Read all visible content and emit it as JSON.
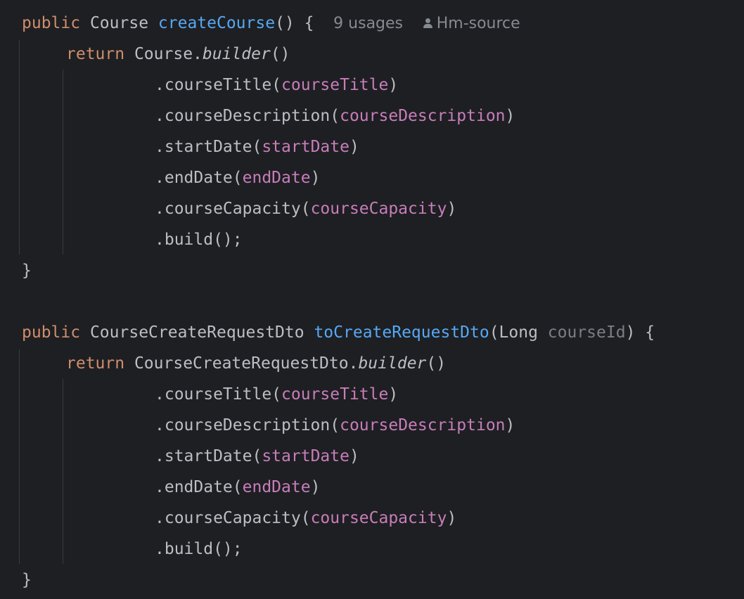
{
  "colors": {
    "background": "#1e1f22",
    "default_text": "#bcbec4",
    "keyword": "#cf8e6d",
    "method_declaration": "#56a8f5",
    "field": "#c77dbb",
    "unused_parameter": "#7a7e85",
    "inlay_hint": "#868a91",
    "indent_guide": "#393b40"
  },
  "code": {
    "method1": {
      "modifier": "public",
      "return_type": "Course",
      "name": "createCourse",
      "signature_tail": "() {",
      "usages_hint": "9 usages",
      "author_icon": "person-icon",
      "author_hint": "Hm-source",
      "return_keyword": "return",
      "builder_class": "Course.",
      "builder_method": "builder",
      "builder_parens": "()",
      "chain": [
        {
          "call": ".courseTitle(",
          "arg": "courseTitle",
          "close": ")"
        },
        {
          "call": ".courseDescription(",
          "arg": "courseDescription",
          "close": ")"
        },
        {
          "call": ".startDate(",
          "arg": "startDate",
          "close": ")"
        },
        {
          "call": ".endDate(",
          "arg": "endDate",
          "close": ")"
        },
        {
          "call": ".courseCapacity(",
          "arg": "courseCapacity",
          "close": ")"
        }
      ],
      "build_call": ".build();",
      "closing_brace": "}"
    },
    "method2": {
      "modifier": "public",
      "return_type": "CourseCreateRequestDto",
      "name": "toCreateRequestDto",
      "param_open": "(Long ",
      "param_name": "courseId",
      "signature_tail": ") {",
      "return_keyword": "return",
      "builder_class": "CourseCreateRequestDto.",
      "builder_method": "builder",
      "builder_parens": "()",
      "chain": [
        {
          "call": ".courseTitle(",
          "arg": "courseTitle",
          "close": ")"
        },
        {
          "call": ".courseDescription(",
          "arg": "courseDescription",
          "close": ")"
        },
        {
          "call": ".startDate(",
          "arg": "startDate",
          "close": ")"
        },
        {
          "call": ".endDate(",
          "arg": "endDate",
          "close": ")"
        },
        {
          "call": ".courseCapacity(",
          "arg": "courseCapacity",
          "close": ")"
        }
      ],
      "build_call": ".build();",
      "closing_brace": "}"
    }
  }
}
